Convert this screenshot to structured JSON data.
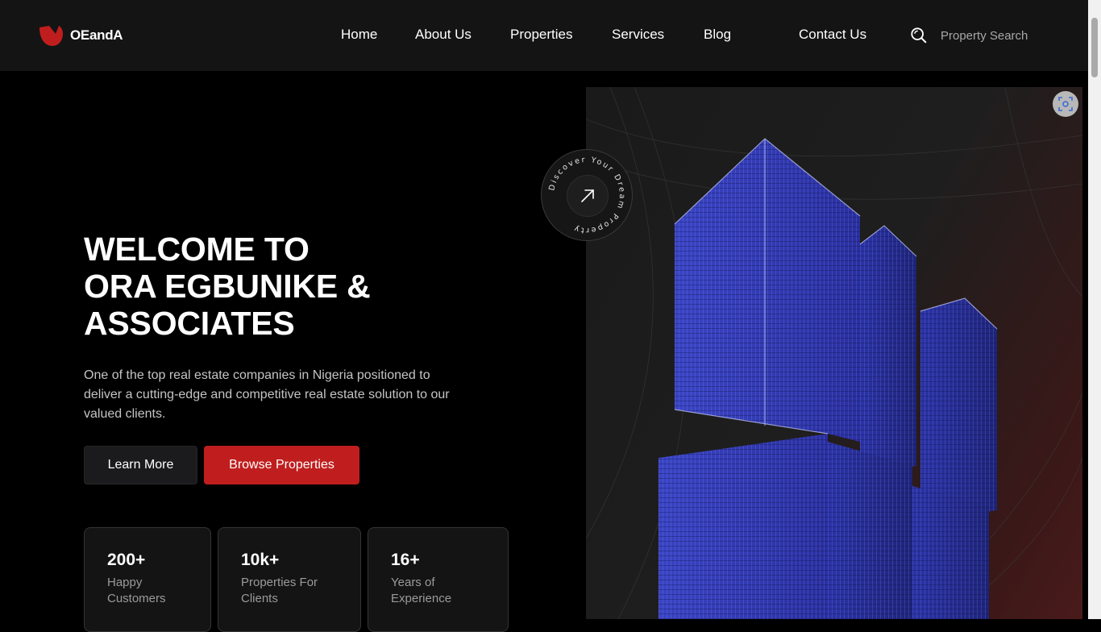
{
  "brand": {
    "name": "OEandA",
    "color": "#c01e1e"
  },
  "nav": {
    "items": [
      {
        "label": "Home"
      },
      {
        "label": "About Us"
      },
      {
        "label": "Properties"
      },
      {
        "label": "Services"
      },
      {
        "label": "Blog"
      },
      {
        "label": "Contact Us"
      }
    ],
    "search_placeholder": "Property Search",
    "search_icon": "search-icon"
  },
  "hero": {
    "title_line1": "WELCOME TO",
    "title_line2": "ORA EGBUNIKE &",
    "title_line3": "ASSOCIATES",
    "description": "One of the top real estate companies in Nigeria positioned to deliver a cutting-edge and competitive real estate solution to our valued clients.",
    "learn_more": "Learn More",
    "browse": "Browse Properties",
    "badge_text": "Discover Your Dream Property",
    "badge_icon": "arrow-up-right-icon"
  },
  "stats": [
    {
      "value": "200+",
      "label": "Happy Customers"
    },
    {
      "value": "10k+",
      "label": "Properties For Clients"
    },
    {
      "value": "16+",
      "label": "Years of Experience"
    }
  ],
  "colors": {
    "accent": "#c01e1e",
    "nav_bg": "#141414",
    "page_bg": "#000000"
  }
}
